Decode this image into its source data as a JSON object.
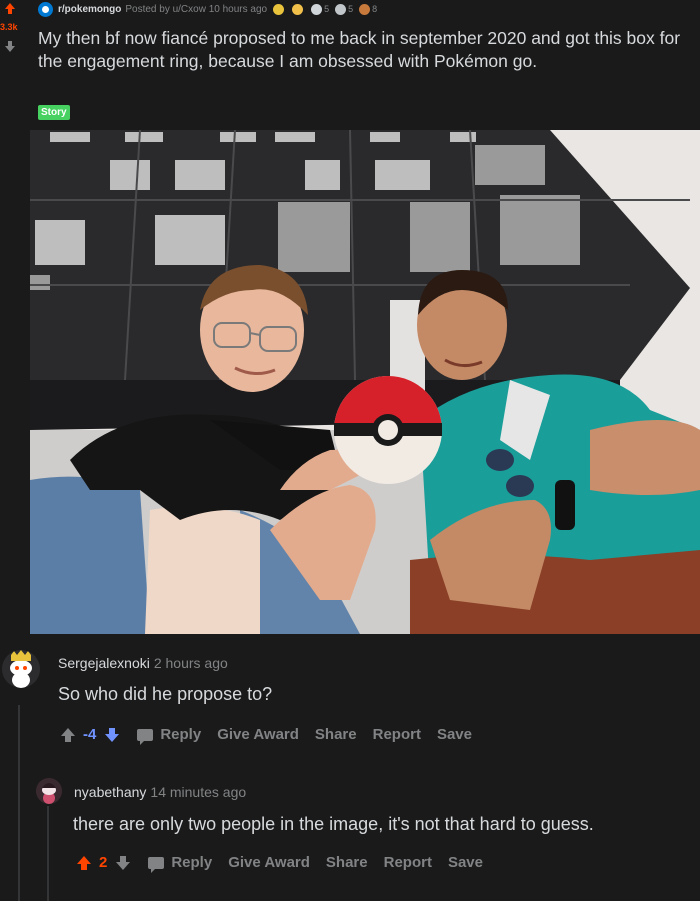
{
  "post": {
    "score": "3.3k",
    "subreddit": "r/pokemongo",
    "posted_by": "Posted by u/Cxow 10 hours ago",
    "awards": [
      {
        "name": "gold-award",
        "color": "#e8c33b",
        "count": ""
      },
      {
        "name": "wholesome-award",
        "color": "#f0c04a",
        "count": ""
      },
      {
        "name": "helpful-award",
        "color": "#cfd5d8",
        "count": "5"
      },
      {
        "name": "silver-award",
        "color": "#c0c6c9",
        "count": "5"
      },
      {
        "name": "poop-award",
        "color": "#c87a3c",
        "count": "8"
      }
    ],
    "title": "My then bf now fiancé proposed to me back in september 2020 and got this box for the engagement ring, because I am obsessed with Pokémon go.",
    "flair": "Story",
    "flair_color": "#46d160",
    "image_alt": "Two men sitting in front of a tall dark building, holding a crocheted Poké Ball ring box"
  },
  "comments": [
    {
      "username": "Sergejalexnoki",
      "time": "2 hours ago",
      "body": "So who did he propose to?",
      "score": "-4",
      "score_color": "#7193ff",
      "actions": {
        "reply": "Reply",
        "award": "Give Award",
        "share": "Share",
        "report": "Report",
        "save": "Save"
      }
    },
    {
      "username": "nyabethany",
      "time": "14 minutes ago",
      "body": "there are only two people in the image, it's not that hard to guess.",
      "score": "2",
      "score_color": "#ff4500",
      "actions": {
        "reply": "Reply",
        "award": "Give Award",
        "share": "Share",
        "report": "Report",
        "save": "Save"
      }
    }
  ]
}
